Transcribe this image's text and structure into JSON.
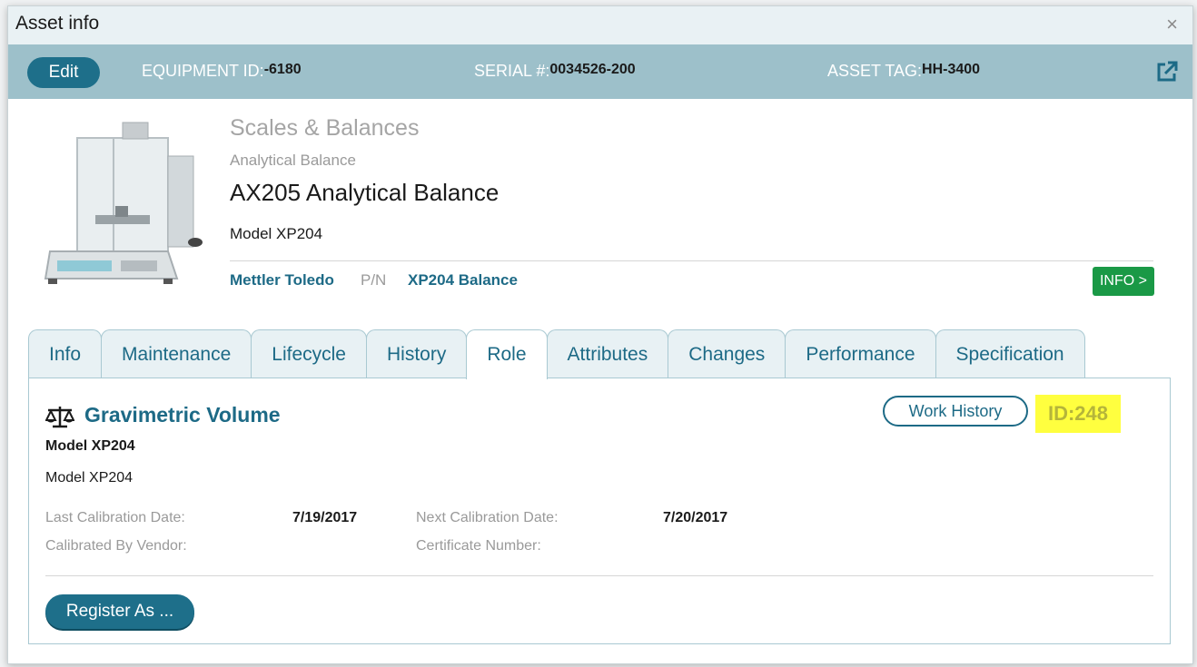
{
  "window": {
    "title": "Asset info",
    "close_glyph": "×"
  },
  "header": {
    "edit_label": "Edit",
    "equipment_id_label": "EQUIPMENT ID:",
    "equipment_id": "-6180",
    "serial_label": "SERIAL #:",
    "serial": "0034526-200",
    "asset_tag_label": "ASSET TAG:",
    "asset_tag": "HH-3400",
    "external_link_icon": "external-link-icon"
  },
  "product": {
    "category": "Scales & Balances",
    "subcategory": "Analytical Balance",
    "name": "AX205 Analytical Balance",
    "model": "Model XP204",
    "manufacturer": "Mettler Toledo",
    "pn_label": "P/N",
    "part_number": "XP204 Balance",
    "info_button": "INFO >"
  },
  "tabs": [
    {
      "label": "Info",
      "active": false
    },
    {
      "label": "Maintenance",
      "active": false
    },
    {
      "label": "Lifecycle",
      "active": false
    },
    {
      "label": "History",
      "active": false
    },
    {
      "label": "Role",
      "active": true
    },
    {
      "label": "Attributes",
      "active": false
    },
    {
      "label": "Changes",
      "active": false
    },
    {
      "label": "Performance",
      "active": false
    },
    {
      "label": "Specification",
      "active": false
    }
  ],
  "role": {
    "icon": "balance-scale-icon",
    "title": "Gravimetric Volume",
    "model_bold": "Model XP204",
    "model": "Model XP204",
    "work_history_label": "Work History",
    "id_badge": "ID:248",
    "last_cal_label": "Last Calibration Date:",
    "last_cal_value": "7/19/2017",
    "next_cal_label": "Next Calibration Date:",
    "next_cal_value": "7/20/2017",
    "vendor_label": "Calibrated By Vendor:",
    "vendor_value": "",
    "cert_label": "Certificate Number:",
    "cert_value": "",
    "register_label": "Register As ..."
  },
  "colors": {
    "accent": "#1e6f8a",
    "header_bar": "#9dc0ca",
    "info_green": "#1a9946",
    "highlight": "#ffff3f"
  }
}
